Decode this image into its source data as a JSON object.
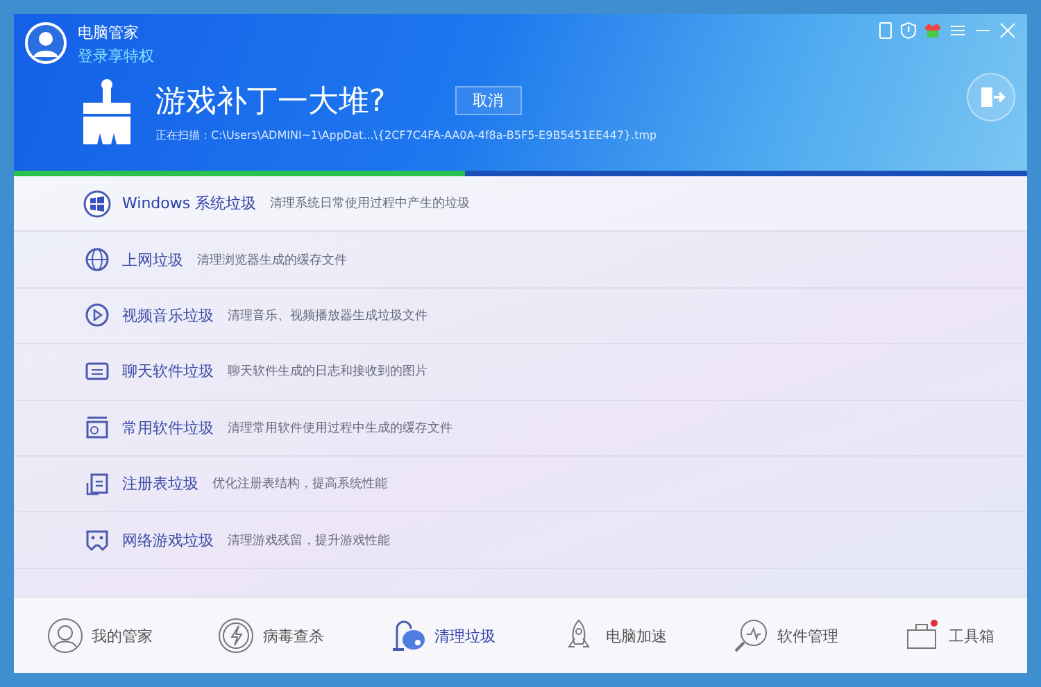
{
  "window": {
    "app_name": "电脑管家",
    "login_link": "登录享特权"
  },
  "scan": {
    "headline": "游戏补丁一大堆?",
    "cancel_button": "取消",
    "path": "正在扫描：C:\\Users\\ADMINI~1\\AppDat...\\{2CF7C4FA-AA0A-4f8a-B5F5-E9B5451EE447}.tmp",
    "level": 0.445
  },
  "categories": [
    {
      "kind": "windows",
      "title": "Windows 系统垃圾",
      "description": "清理系统日常使用过程中产生的垃圾",
      "selected": true
    },
    {
      "kind": "globe",
      "title": "上网垃圾",
      "description": "清理浏览器生成的缓存文件",
      "selected": false
    },
    {
      "kind": "play",
      "title": "视频音乐垃圾",
      "description": "清理音乐、视频播放器生成垃圾文件",
      "selected": false
    },
    {
      "kind": "chat",
      "title": "聊天软件垃圾",
      "description": "聊天软件生成的日志和接收到的图片",
      "selected": false
    },
    {
      "kind": "app",
      "title": "常用软件垃圾",
      "description": "清理常用软件使用过程中生成的缓存文件",
      "selected": false
    },
    {
      "kind": "registry",
      "title": "注册表垃圾",
      "description": "优化注册表结构，提高系统性能",
      "selected": false
    },
    {
      "kind": "game",
      "title": "网络游戏垃圾",
      "description": "清理游戏残留，提升游戏性能",
      "selected": false
    }
  ],
  "nav": [
    {
      "kind": "person",
      "label": "我的管家",
      "selected": false
    },
    {
      "kind": "bolt",
      "label": "病毒查杀",
      "selected": false
    },
    {
      "kind": "vacuum",
      "label": "清理垃圾",
      "selected": true
    },
    {
      "kind": "rocket",
      "label": "电脑加速",
      "selected": false
    },
    {
      "kind": "magnifier",
      "label": "软件管理",
      "selected": false
    },
    {
      "kind": "toolbox",
      "label": "工具箱",
      "selected": false
    }
  ]
}
